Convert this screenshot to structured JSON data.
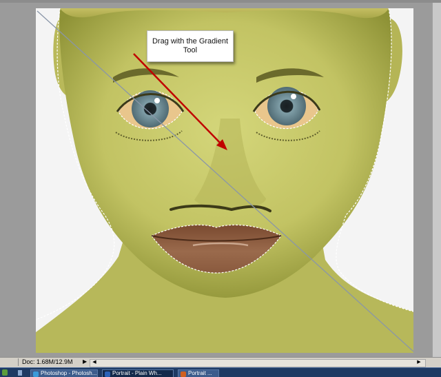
{
  "annotation": {
    "callout_text": "Drag with the Gradient Tool"
  },
  "colors": {
    "skin": "#c6c56a",
    "skin_shadow": "#8e9236",
    "lips": "#8c5a3c",
    "eye_white": "#e9c68c",
    "iris": "#6f8f9a",
    "arrow": "#c00000",
    "gradient_line": "#8a96a8",
    "background": "#f4f4f4"
  },
  "status_bar": {
    "zoom": "",
    "doc_size": "Doc: 1.68M/12.9M",
    "arrow_glyph": "▶"
  },
  "taskbar": {
    "items": [
      {
        "label": "Photoshop - Photosh...",
        "icon_color": "#3a9ad9",
        "icon": "photoshop-icon"
      },
      {
        "label": "Portrait - Plain Wh...",
        "icon_color": "#2b62b8",
        "icon": "document-icon"
      },
      {
        "label": "Portrait ...",
        "icon_color": "#d06020",
        "icon": "document-icon"
      }
    ]
  }
}
